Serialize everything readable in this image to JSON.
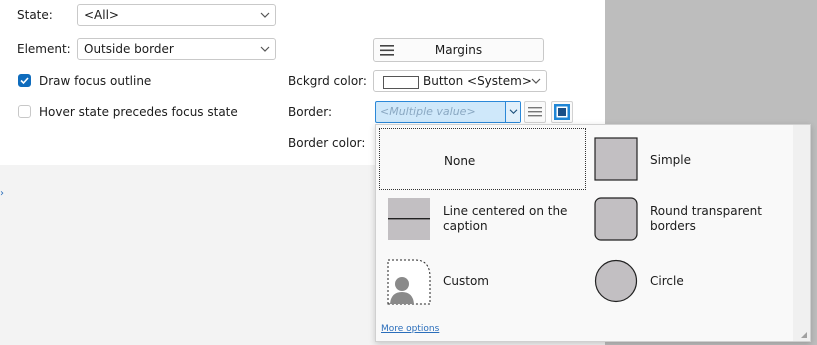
{
  "form": {
    "state": {
      "label": "State:",
      "value": "<All>"
    },
    "element": {
      "label": "Element:",
      "value": "Outside border"
    },
    "draw_focus": {
      "label": "Draw focus outline",
      "checked": true
    },
    "hover_state": {
      "label": "Hover state precedes focus state",
      "checked": false
    },
    "margins_button": "Margins",
    "bckgrd": {
      "label": "Bckgrd color:",
      "value": "Button <System>"
    },
    "border": {
      "label": "Border:",
      "placeholder": "<Multiple value>"
    },
    "border_color": {
      "label": "Border color:"
    }
  },
  "popup": {
    "options": [
      {
        "label": "None",
        "icon": "none-border-icon",
        "selected": true
      },
      {
        "label": "Simple",
        "icon": "simple-border-icon",
        "selected": false
      },
      {
        "label": "Line centered on the caption",
        "icon": "line-centered-border-icon",
        "selected": false
      },
      {
        "label": "Round transparent borders",
        "icon": "round-border-icon",
        "selected": false
      },
      {
        "label": "Custom",
        "icon": "custom-border-icon",
        "selected": false
      },
      {
        "label": "Circle",
        "icon": "circle-border-icon",
        "selected": false
      }
    ],
    "more_options": "More options"
  },
  "colors": {
    "accent": "#0f6cbd",
    "selection_bg": "#cfe8fa",
    "selection_border": "#2b88d8",
    "icon_fill": "#c2bfc2",
    "right_panel": "#bdbdbd"
  }
}
